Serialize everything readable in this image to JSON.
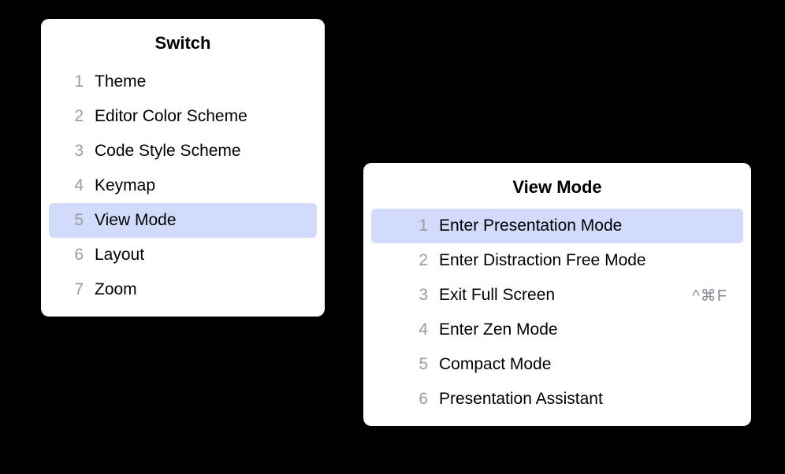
{
  "switch_popup": {
    "title": "Switch",
    "items": [
      {
        "number": "1",
        "label": "Theme",
        "selected": false
      },
      {
        "number": "2",
        "label": "Editor Color Scheme",
        "selected": false
      },
      {
        "number": "3",
        "label": "Code Style Scheme",
        "selected": false
      },
      {
        "number": "4",
        "label": "Keymap",
        "selected": false
      },
      {
        "number": "5",
        "label": "View Mode",
        "selected": true
      },
      {
        "number": "6",
        "label": "Layout",
        "selected": false
      },
      {
        "number": "7",
        "label": "Zoom",
        "selected": false
      }
    ]
  },
  "viewmode_popup": {
    "title": "View Mode",
    "items": [
      {
        "number": "1",
        "label": "Enter Presentation Mode",
        "shortcut": "",
        "selected": true
      },
      {
        "number": "2",
        "label": "Enter Distraction Free Mode",
        "shortcut": "",
        "selected": false
      },
      {
        "number": "3",
        "label": "Exit Full Screen",
        "shortcut": "^⌘F",
        "selected": false
      },
      {
        "number": "4",
        "label": "Enter Zen Mode",
        "shortcut": "",
        "selected": false
      },
      {
        "number": "5",
        "label": "Compact Mode",
        "shortcut": "",
        "selected": false
      },
      {
        "number": "6",
        "label": "Presentation Assistant",
        "shortcut": "",
        "selected": false
      }
    ]
  }
}
